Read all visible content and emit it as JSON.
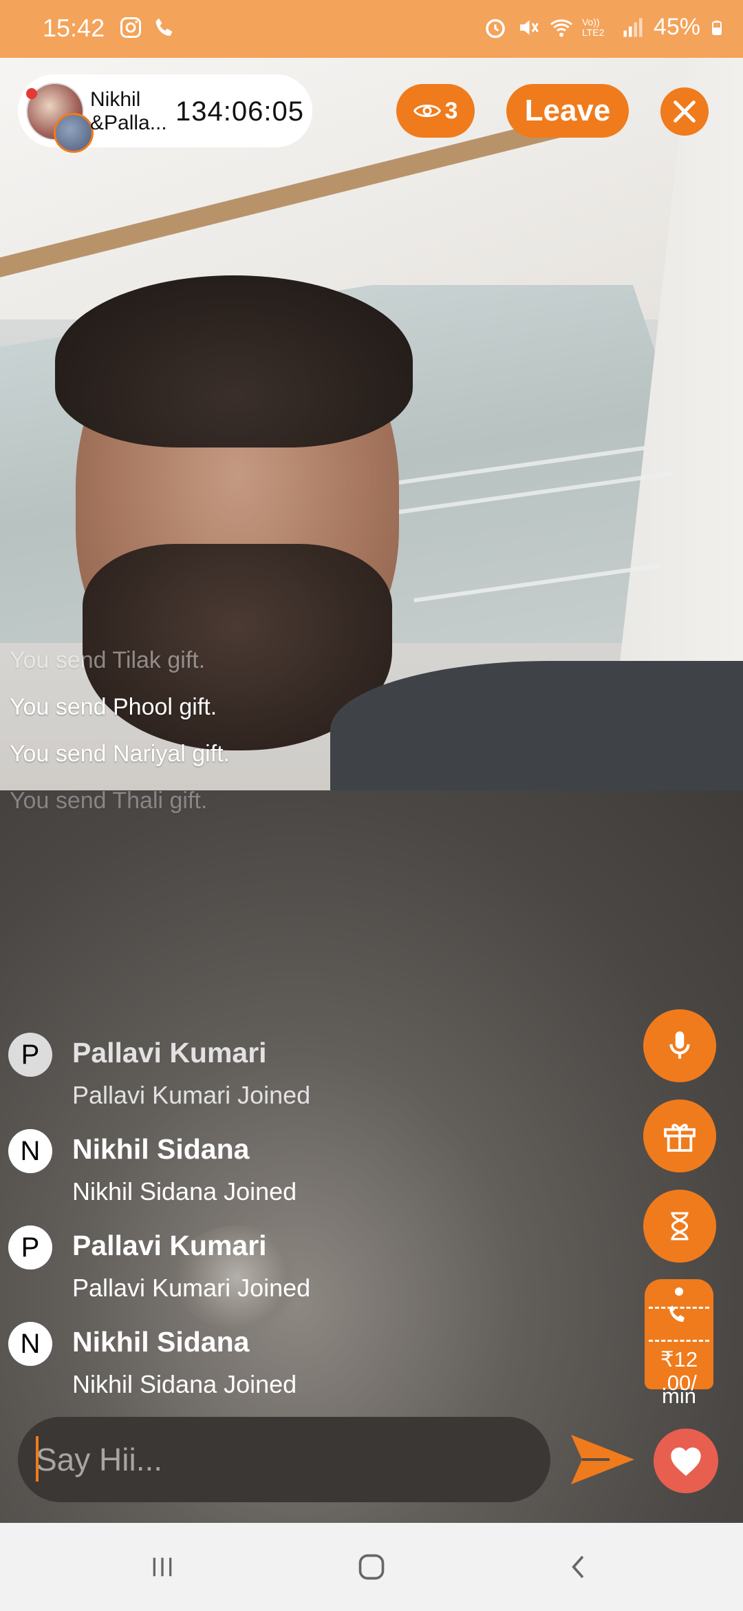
{
  "status_bar": {
    "time": "15:42",
    "left_icons": [
      "instagram-icon",
      "call-icon"
    ],
    "battery": "45%",
    "network_label": "Vo)) LTE2",
    "right_icons": [
      "alarm-icon",
      "mute-icon",
      "wifi-icon",
      "signal-icon",
      "battery-icon"
    ]
  },
  "host": {
    "name": "Nikhil &Palla...",
    "timer": "134:06:05"
  },
  "header": {
    "viewers": "3",
    "leave_label": "Leave"
  },
  "gift_messages": [
    "You send Tilak gift.",
    "You send Phool gift.",
    "You send Nariyal gift.",
    "You send Thali gift."
  ],
  "chat": [
    {
      "initial": "P",
      "name": "Pallavi Kumari",
      "message": "Pallavi Kumari Joined"
    },
    {
      "initial": "N",
      "name": "Nikhil Sidana",
      "message": "Nikhil Sidana Joined"
    },
    {
      "initial": "P",
      "name": "Pallavi Kumari",
      "message": "Pallavi Kumari Joined"
    },
    {
      "initial": "N",
      "name": "Nikhil Sidana",
      "message": "Nikhil Sidana Joined"
    }
  ],
  "actions": {
    "call_rate": "₹12 .00/",
    "call_unit": "min",
    "icons": [
      "mic-icon",
      "gift-icon",
      "hourglass-icon",
      "phone-icon"
    ]
  },
  "composer": {
    "placeholder": "Say Hii..."
  },
  "colors": {
    "accent": "#f07b1c",
    "status_bar": "#f4a35a",
    "heart": "#e95f4f"
  }
}
